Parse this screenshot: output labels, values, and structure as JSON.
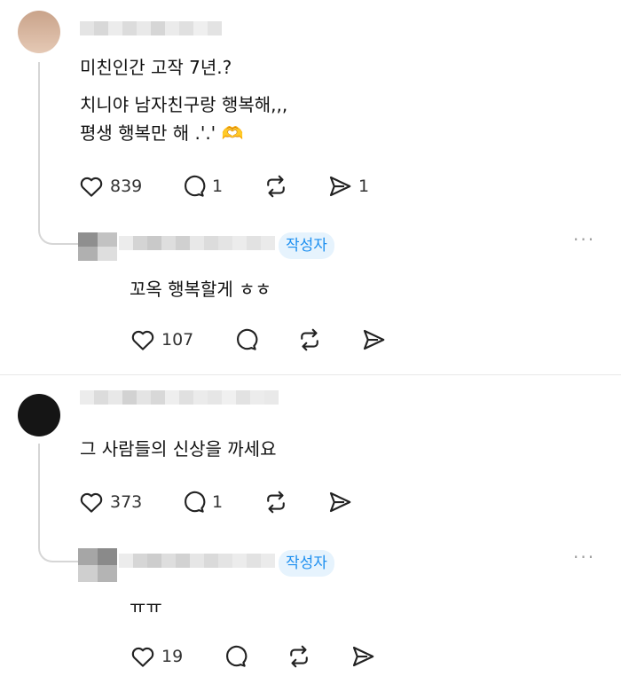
{
  "comments": [
    {
      "body": [
        "미친인간 고작 7년.?",
        "치니야 남자친구랑 행복해,,,",
        "평생 행복만 해 .'.'"
      ],
      "emoji": "🫶",
      "likes": "839",
      "replies": "1",
      "shares": "1",
      "reply": {
        "badge": "작성자",
        "body": "꼬옥 행복할게 ㅎㅎ",
        "likes": "107",
        "more": "···"
      }
    },
    {
      "body": [
        "그 사람들의 신상을 까세요"
      ],
      "likes": "373",
      "replies": "1",
      "reply": {
        "badge": "작성자",
        "body": "ㅠㅠ",
        "likes": "19",
        "more": "···"
      }
    }
  ],
  "icons": [
    "heart-icon",
    "comment-icon",
    "repost-icon",
    "share-icon",
    "more-icon"
  ],
  "colors": {
    "badge_bg": "#e6f3fd",
    "badge_text": "#1d8ff0",
    "icon": "#222222",
    "thread_line": "#d6d6d6"
  }
}
